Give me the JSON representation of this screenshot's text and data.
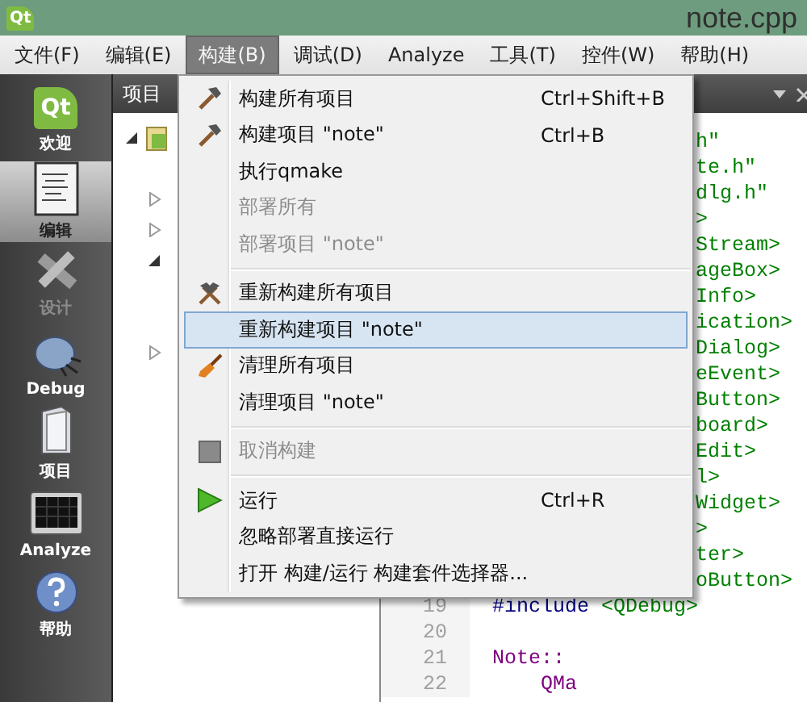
{
  "window": {
    "logo": "Qt",
    "title": "note.cpp"
  },
  "menubar": [
    {
      "label": "文件(F)",
      "selected": false
    },
    {
      "label": "编辑(E)",
      "selected": false
    },
    {
      "label": "构建(B)",
      "selected": true
    },
    {
      "label": "调试(D)",
      "selected": false
    },
    {
      "label": "Analyze",
      "selected": false
    },
    {
      "label": "工具(T)",
      "selected": false
    },
    {
      "label": "控件(W)",
      "selected": false
    },
    {
      "label": "帮助(H)",
      "selected": false
    }
  ],
  "modes": [
    {
      "kind": "welcome",
      "logo": "Qt",
      "label": "欢迎",
      "selected": false,
      "disabled": false
    },
    {
      "kind": "edit",
      "label": "编辑",
      "selected": true,
      "disabled": false
    },
    {
      "kind": "design",
      "label": "设计",
      "selected": false,
      "disabled": true
    },
    {
      "kind": "debug",
      "label": "Debug",
      "selected": false,
      "disabled": false
    },
    {
      "kind": "projects",
      "label": "项目",
      "selected": false,
      "disabled": false
    },
    {
      "kind": "analyze",
      "label": "Analyze",
      "selected": false,
      "disabled": false
    },
    {
      "kind": "help",
      "label": "帮助",
      "selected": false,
      "disabled": false
    }
  ],
  "projects": {
    "title": "项目",
    "tree": [
      {
        "kind": "project",
        "expanded": true,
        "children": [
          {
            "kind": "file"
          },
          {
            "kind": "folder",
            "expanded": false
          },
          {
            "kind": "folder",
            "expanded": false
          },
          {
            "kind": "folder",
            "expanded": true,
            "children": [
              {
                "kind": "file"
              },
              {
                "kind": "file"
              }
            ]
          },
          {
            "kind": "folder",
            "expanded": false
          }
        ]
      }
    ]
  },
  "editor": {
    "lines": [
      {
        "kind": "fragment",
        "tokens": [
          {
            "kind": "string",
            "text": "h\""
          }
        ]
      },
      {
        "kind": "fragment",
        "tokens": [
          {
            "kind": "string",
            "text": "te.h\""
          }
        ]
      },
      {
        "kind": "fragment",
        "tokens": [
          {
            "kind": "string",
            "text": "dlg.h\""
          }
        ]
      },
      {
        "kind": "fragment",
        "tokens": [
          {
            "kind": "string",
            "text": ">"
          }
        ]
      },
      {
        "kind": "fragment",
        "tokens": [
          {
            "kind": "string",
            "text": "Stream>"
          }
        ]
      },
      {
        "kind": "fragment",
        "tokens": [
          {
            "kind": "string",
            "text": "ageBox>"
          }
        ]
      },
      {
        "kind": "fragment",
        "tokens": [
          {
            "kind": "string",
            "text": "Info>"
          }
        ]
      },
      {
        "kind": "fragment",
        "tokens": [
          {
            "kind": "string",
            "text": "ication>"
          }
        ]
      },
      {
        "kind": "fragment",
        "tokens": [
          {
            "kind": "string",
            "text": "Dialog>"
          }
        ]
      },
      {
        "kind": "fragment",
        "tokens": [
          {
            "kind": "string",
            "text": "eEvent>"
          }
        ]
      },
      {
        "kind": "fragment",
        "tokens": [
          {
            "kind": "string",
            "text": "Button>"
          }
        ]
      },
      {
        "kind": "fragment",
        "tokens": [
          {
            "kind": "string",
            "text": "board>"
          }
        ]
      },
      {
        "kind": "fragment",
        "tokens": [
          {
            "kind": "string",
            "text": "Edit>"
          }
        ]
      },
      {
        "kind": "fragment",
        "tokens": [
          {
            "kind": "string",
            "text": "l>"
          }
        ]
      },
      {
        "kind": "fragment",
        "tokens": [
          {
            "kind": "string",
            "text": "Widget>"
          }
        ]
      },
      {
        "kind": "fragment",
        "tokens": [
          {
            "kind": "string",
            "text": ">"
          }
        ]
      },
      {
        "kind": "fragment",
        "tokens": [
          {
            "kind": "string",
            "text": "ter>"
          }
        ]
      },
      {
        "kind": "fragment",
        "tokens": [
          {
            "kind": "string",
            "text": "oButton>"
          }
        ]
      },
      {
        "kind": "line",
        "number": "19",
        "tokens": [
          {
            "kind": "directive",
            "text": "#include"
          },
          {
            "kind": "string",
            "text": " <QDebug>"
          }
        ]
      },
      {
        "kind": "line",
        "number": "20"
      },
      {
        "kind": "line",
        "number": "21",
        "tokens": [
          {
            "kind": "type",
            "text": "Note::"
          }
        ]
      },
      {
        "kind": "indented",
        "number": "22",
        "tokens": [
          {
            "kind": "type",
            "text": "QMa"
          }
        ]
      }
    ]
  },
  "build_menu": [
    {
      "kind": "build",
      "label": "构建所有项目",
      "shortcut": "Ctrl+Shift+B",
      "disabled": false,
      "selected": false
    },
    {
      "kind": "build",
      "label": "构建项目 \"note\"",
      "shortcut": "Ctrl+B",
      "disabled": false,
      "selected": false
    },
    {
      "kind": "item",
      "label": "执行qmake",
      "disabled": false,
      "selected": false
    },
    {
      "kind": "item",
      "label": "部署所有",
      "disabled": true,
      "selected": false
    },
    {
      "kind": "item",
      "label": "部署项目 \"note\"",
      "disabled": true,
      "selected": false
    },
    {
      "kind": "separator"
    },
    {
      "kind": "rebuild",
      "label": "重新构建所有项目",
      "disabled": false,
      "selected": false
    },
    {
      "kind": "item",
      "label": "重新构建项目 \"note\"",
      "disabled": false,
      "selected": true
    },
    {
      "kind": "clean",
      "label": "清理所有项目",
      "disabled": false,
      "selected": false
    },
    {
      "kind": "item",
      "label": "清理项目 \"note\"",
      "disabled": false,
      "selected": false
    },
    {
      "kind": "separator"
    },
    {
      "kind": "cancel",
      "label": "取消构建",
      "disabled": true,
      "selected": false
    },
    {
      "kind": "separator"
    },
    {
      "kind": "run",
      "label": "运行",
      "shortcut": "Ctrl+R",
      "disabled": false,
      "selected": false
    },
    {
      "kind": "item",
      "label": "忽略部署直接运行",
      "disabled": false,
      "selected": false
    },
    {
      "kind": "item",
      "label": "打开 构建/运行 构建套件选择器...",
      "disabled": false,
      "selected": false
    }
  ]
}
